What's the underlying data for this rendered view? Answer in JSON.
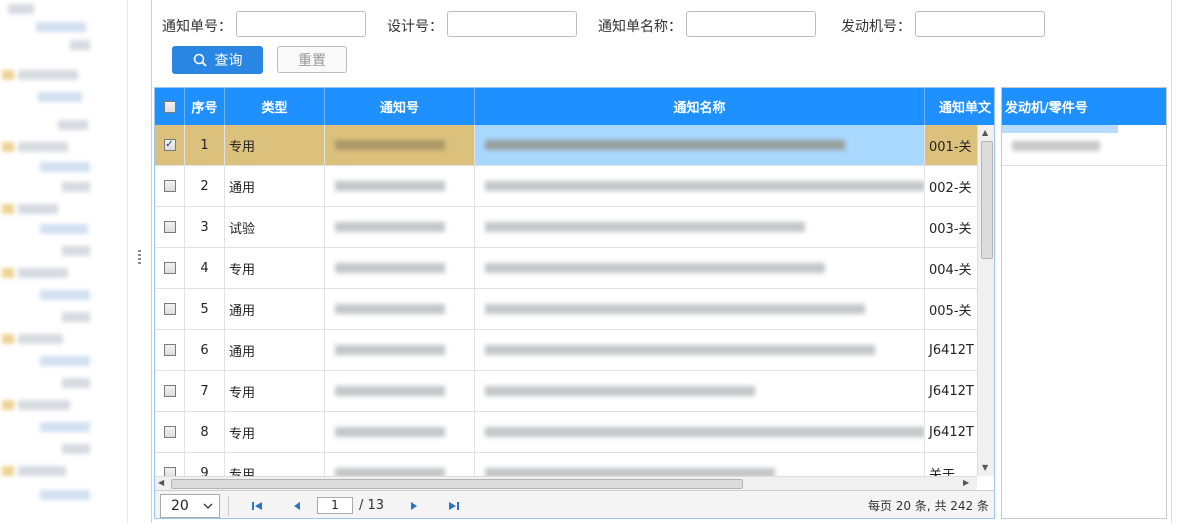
{
  "search_form": {
    "notice_no_label": "通知单号：",
    "design_no_label": "设计号：",
    "notice_name_label": "通知单名称：",
    "engine_no_label": "发动机号：",
    "query_label": "查询",
    "reset_label": "重置"
  },
  "grid": {
    "columns": {
      "seq": "序号",
      "type": "类型",
      "notice_no": "通知号",
      "notice_name": "通知名称",
      "notice_doc": "通知单文"
    },
    "rows": [
      {
        "seq": "1",
        "type": "专用",
        "doc": "001-关",
        "checked": true
      },
      {
        "seq": "2",
        "type": "通用",
        "doc": "002-关",
        "checked": false
      },
      {
        "seq": "3",
        "type": "试验",
        "doc": "003-关",
        "checked": false
      },
      {
        "seq": "4",
        "type": "专用",
        "doc": "004-关",
        "checked": false
      },
      {
        "seq": "5",
        "type": "通用",
        "doc": "005-关",
        "checked": false
      },
      {
        "seq": "6",
        "type": "通用",
        "doc": "J6412T",
        "checked": false
      },
      {
        "seq": "7",
        "type": "专用",
        "doc": "J6412T",
        "checked": false
      },
      {
        "seq": "8",
        "type": "专用",
        "doc": "J6412T",
        "checked": false
      },
      {
        "seq": "9",
        "type": "专用",
        "doc": "关于",
        "checked": false
      }
    ]
  },
  "pager": {
    "page_size": "20",
    "current_page": "1",
    "total_pages": "/ 13",
    "summary": "每页 20 条, 共 242 条"
  },
  "engine_panel": {
    "title": "发动机/零件号"
  },
  "colors": {
    "header_blue": "#1e90ff",
    "selected_row": "#dcc17d",
    "query_button": "#2a86e3"
  },
  "icons": [
    "search-icon",
    "first-page-icon",
    "prev-page-icon",
    "next-page-icon",
    "last-page-icon",
    "chevron-down-icon",
    "splitter-grip-icon"
  ]
}
